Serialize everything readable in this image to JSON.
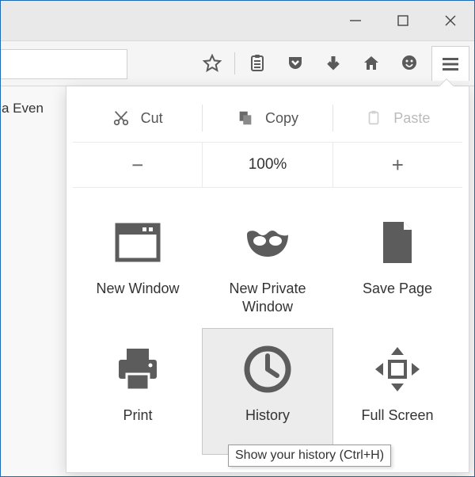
{
  "tab_fragment": "a Even",
  "toolbar_icons": [
    "star",
    "clipboard-list",
    "pocket",
    "download",
    "home",
    "smiley",
    "hamburger"
  ],
  "edit": {
    "cut": "Cut",
    "copy": "Copy",
    "paste": "Paste"
  },
  "zoom": {
    "level": "100%"
  },
  "grid": {
    "new_window": "New Window",
    "new_private": "New Private Window",
    "save_page": "Save Page",
    "print": "Print",
    "history": "History",
    "full_screen": "Full Screen"
  },
  "tooltip": "Show your history (Ctrl+H)"
}
